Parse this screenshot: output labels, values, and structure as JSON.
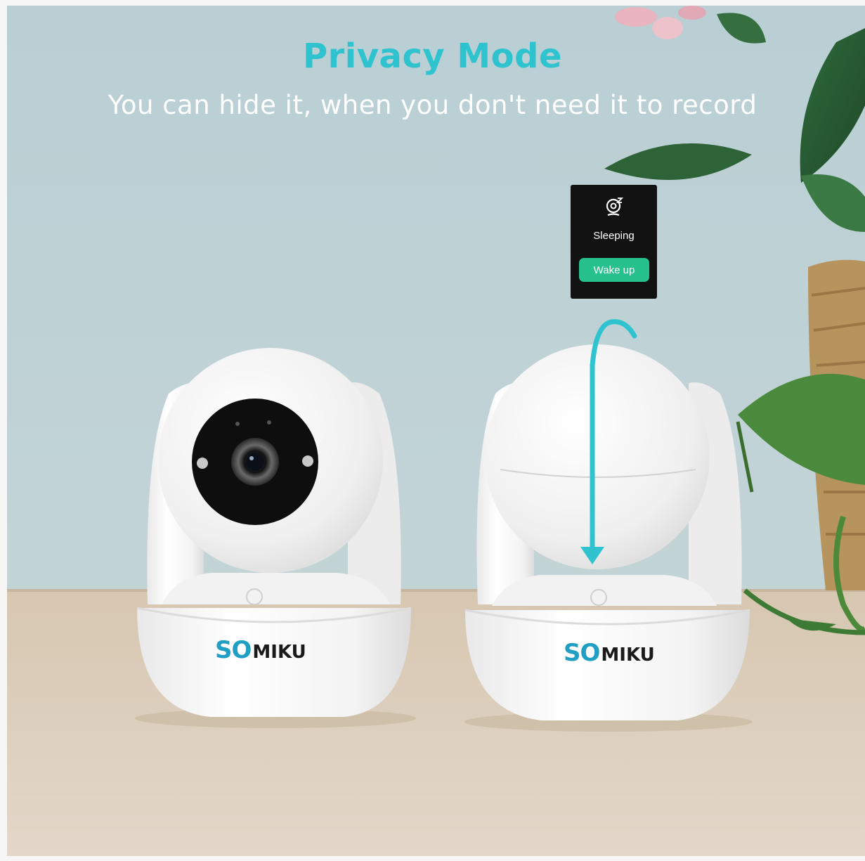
{
  "headline": "Privacy Mode",
  "subheadline": "You can hide it, when you don't need it to record",
  "app_popup": {
    "icon": "sleeping-camera-icon",
    "status": "Sleeping",
    "button": "Wake up"
  },
  "brand": {
    "mark": "SO",
    "word": "MIKU"
  },
  "colors": {
    "accent": "#2fc3cf",
    "wake_button": "#27c18e",
    "popup_background": "#121212",
    "brand_blue": "#1e9fc3"
  }
}
